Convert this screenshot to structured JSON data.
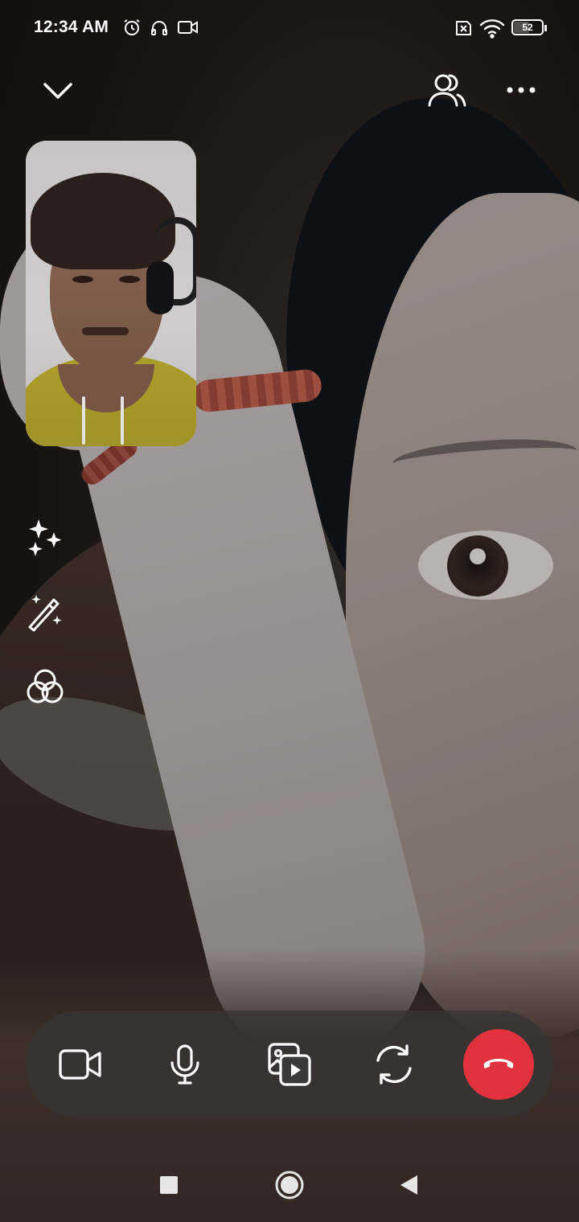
{
  "status_bar": {
    "time": "12:34 AM",
    "icons": [
      "alarm-icon",
      "headphones-icon",
      "video-camera-icon"
    ],
    "right_icons": [
      "sim-x-icon",
      "wifi-icon",
      "battery-icon"
    ],
    "battery_percent": 52,
    "battery_label": "52"
  },
  "top_bar": {
    "minimize_icon": "chevron-down-icon",
    "participants_icon": "people-icon",
    "more_icon": "more-dots-icon"
  },
  "effects": [
    "sparkles-icon",
    "magic-wand-icon",
    "color-filter-icon"
  ],
  "call_controls": {
    "buttons": [
      "video-camera-icon",
      "microphone-icon",
      "media-share-icon",
      "switch-camera-icon",
      "end-call-icon"
    ],
    "end_call_color": "#e2323f",
    "bar_color": "#343434"
  },
  "nav_bar": {
    "buttons": [
      "recents-square-icon",
      "home-circle-icon",
      "back-triangle-icon"
    ]
  }
}
